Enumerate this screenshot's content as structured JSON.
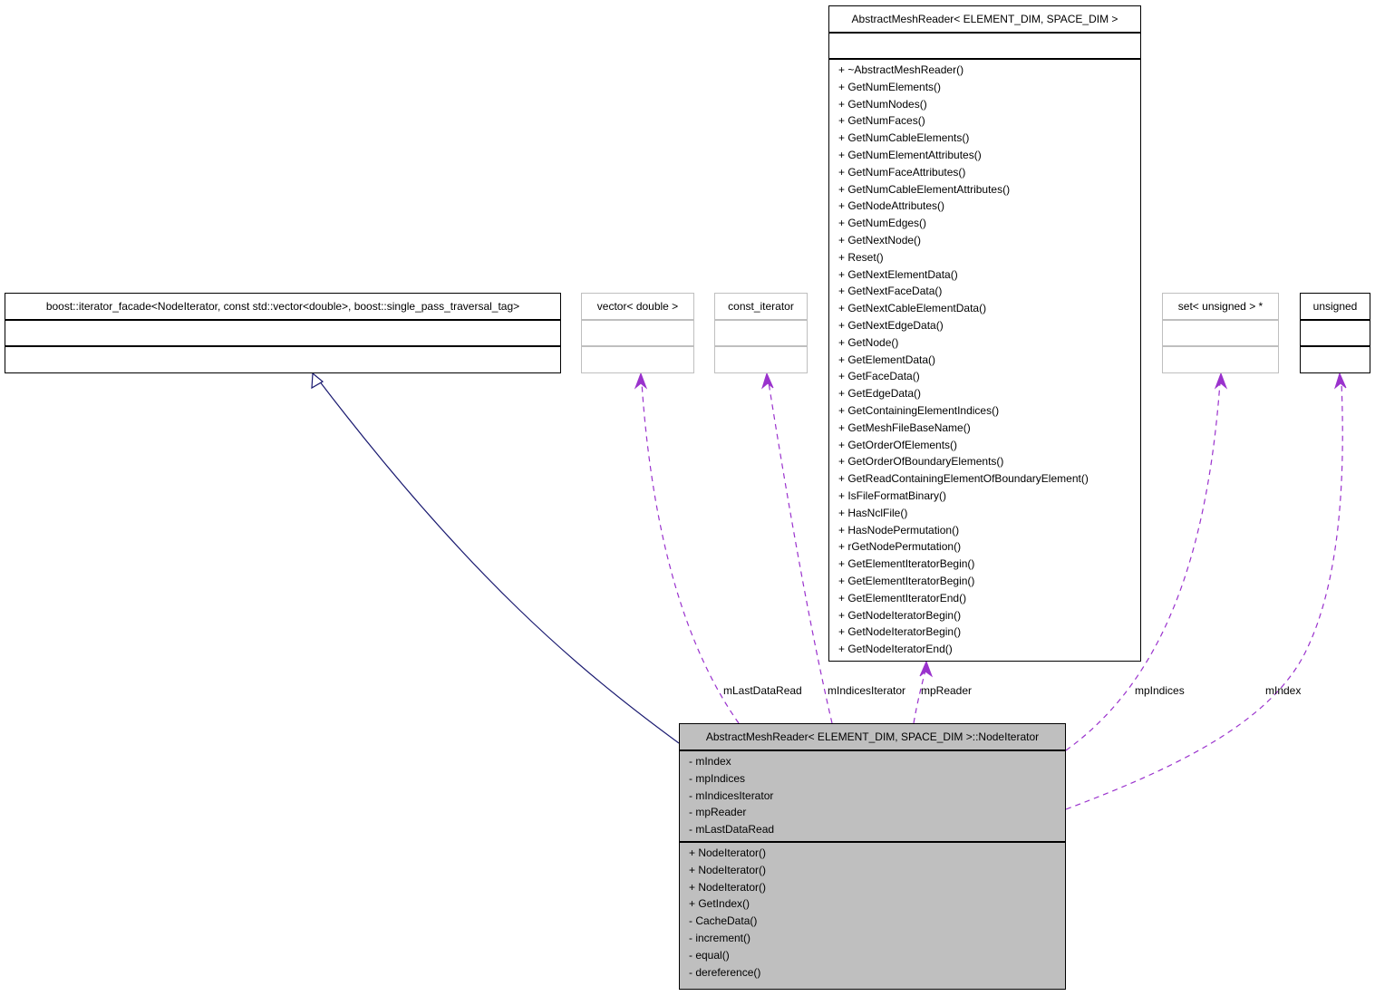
{
  "diagram": {
    "type": "uml-collaboration",
    "colors": {
      "inheritance_edge": "#191970",
      "usage_edge": "#9a32cd",
      "main_class_fill": "#bfbfbf",
      "external_class_border": "#bfbfbf"
    },
    "classes": {
      "abstract_mesh_reader": {
        "name": "AbstractMeshReader< ELEMENT_DIM, SPACE_DIM >",
        "attributes": [],
        "methods": [
          "+ ~AbstractMeshReader()",
          "+ GetNumElements()",
          "+ GetNumNodes()",
          "+ GetNumFaces()",
          "+ GetNumCableElements()",
          "+ GetNumElementAttributes()",
          "+ GetNumFaceAttributes()",
          "+ GetNumCableElementAttributes()",
          "+ GetNodeAttributes()",
          "+ GetNumEdges()",
          "+ GetNextNode()",
          "+ Reset()",
          "+ GetNextElementData()",
          "+ GetNextFaceData()",
          "+ GetNextCableElementData()",
          "+ GetNextEdgeData()",
          "+ GetNode()",
          "+ GetElementData()",
          "+ GetFaceData()",
          "+ GetEdgeData()",
          "+ GetContainingElementIndices()",
          "+ GetMeshFileBaseName()",
          "+ GetOrderOfElements()",
          "+ GetOrderOfBoundaryElements()",
          "+ GetReadContainingElementOfBoundaryElement()",
          "+ IsFileFormatBinary()",
          "+ HasNclFile()",
          "+ HasNodePermutation()",
          "+ rGetNodePermutation()",
          "+ GetElementIteratorBegin()",
          "+ GetElementIteratorBegin()",
          "+ GetElementIteratorEnd()",
          "+ GetNodeIteratorBegin()",
          "+ GetNodeIteratorBegin()",
          "+ GetNodeIteratorEnd()"
        ]
      },
      "iterator_facade": {
        "name": "boost::iterator_facade<NodeIterator, const std::vector<double>, boost::single_pass_traversal_tag>"
      },
      "vector_double": {
        "name": "vector< double >"
      },
      "const_iterator": {
        "name": "const_iterator"
      },
      "set_unsigned": {
        "name": "set< unsigned > *"
      },
      "unsigned": {
        "name": "unsigned"
      },
      "node_iterator": {
        "name": "AbstractMeshReader< ELEMENT_DIM, SPACE_DIM >::NodeIterator",
        "attributes": [
          "- mIndex",
          "- mpIndices",
          "- mIndicesIterator",
          "- mpReader",
          "- mLastDataRead"
        ],
        "methods": [
          "+ NodeIterator()",
          "+ NodeIterator()",
          "+ NodeIterator()",
          "+ GetIndex()",
          "- CacheData()",
          "- increment()",
          "- equal()",
          "- dereference()"
        ]
      }
    },
    "edges": {
      "inherits": {
        "from": "node_iterator",
        "to": "iterator_facade",
        "kind": "inheritance"
      },
      "mLastDataRead": {
        "label": "mLastDataRead",
        "from": "node_iterator",
        "to": "vector_double",
        "kind": "usage"
      },
      "mIndicesIterator": {
        "label": "mIndicesIterator",
        "from": "node_iterator",
        "to": "const_iterator",
        "kind": "usage"
      },
      "mpReader": {
        "label": "mpReader",
        "from": "node_iterator",
        "to": "abstract_mesh_reader",
        "kind": "usage"
      },
      "mpIndices": {
        "label": "mpIndices",
        "from": "node_iterator",
        "to": "set_unsigned",
        "kind": "usage"
      },
      "mIndex": {
        "label": "mIndex",
        "from": "node_iterator",
        "to": "unsigned",
        "kind": "usage"
      }
    }
  }
}
